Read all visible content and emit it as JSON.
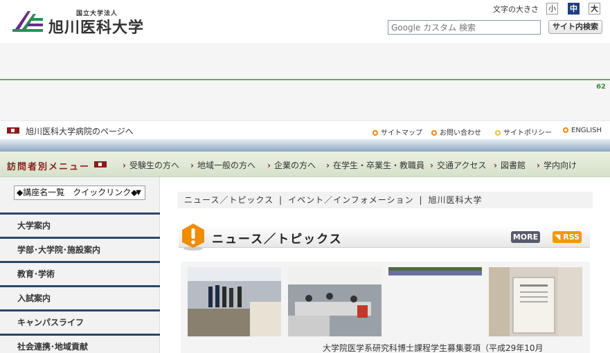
{
  "header": {
    "logo_sub": "国立大学法人",
    "logo_name": "旭川医科大学",
    "fontsize_label": "文字の大きさ",
    "fontsize": {
      "small": "小",
      "mid": "中",
      "large": "大"
    },
    "search_placeholder": "Google カスタム 検索",
    "search_button": "サイト内検索"
  },
  "banner": {
    "counter": "62"
  },
  "hospital": {
    "link": "旭川医科大学病院のページへ",
    "top_links": [
      "サイトマップ",
      "お問い合わせ",
      "サイトポリシー",
      "ENGLISH"
    ]
  },
  "visitor": {
    "title": "訪問者別メニュー",
    "links": [
      "受験生の方へ",
      "地域一般の方へ",
      "企業の方へ",
      "在学生・卒業生・教職員",
      "交通アクセス",
      "図書館",
      "学内向け"
    ]
  },
  "sidebar": {
    "quick_select": "◆講座名一覧　クイックリンク◆",
    "items": [
      "大学案内",
      "学部･大学院･施設案内",
      "教育･学術",
      "入試案内",
      "キャンパスライフ",
      "社会連携･地域貢献"
    ]
  },
  "main": {
    "breadcrumb": [
      "ニュース／トピックス",
      "イベント／インフォメーション",
      "旭川医科大学"
    ],
    "news_title": "ニュース／トピックス",
    "more": "MORE",
    "rss": "RSS",
    "news_item": "大学院医学系研究科博士課程学生募集要項（平成29年10月"
  },
  "colors": {
    "accent_red": "#8b1c1c",
    "navy": "#2c4666",
    "orange": "#f39800",
    "green": "#6fa86a"
  }
}
